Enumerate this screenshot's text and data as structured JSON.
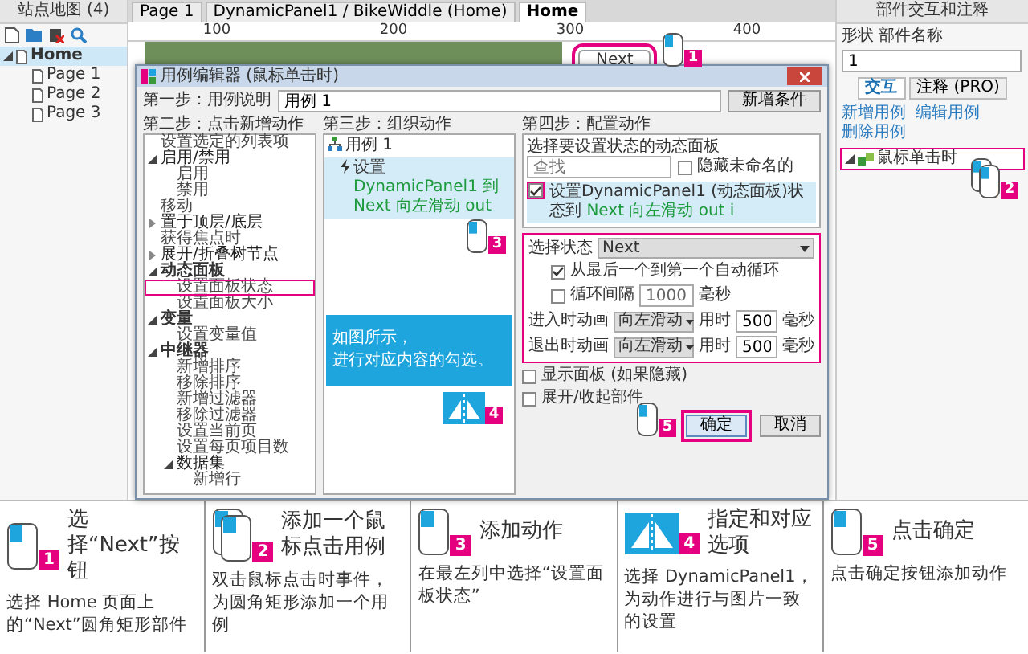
{
  "sitemap": {
    "title": "站点地图 (4)",
    "pages": [
      {
        "label": "Home",
        "selected": true,
        "expanded": true,
        "children": [
          {
            "label": "Page 1",
            "selected": false
          },
          {
            "label": "Page 2",
            "selected": false
          },
          {
            "label": "Page 3",
            "selected": false
          }
        ]
      }
    ]
  },
  "tabs": [
    {
      "label": "Page 1",
      "selected": false
    },
    {
      "label": "DynamicPanel1 / BikeWiddle (Home)",
      "selected": false
    },
    {
      "label": "Home",
      "selected": true
    }
  ],
  "ruler": [
    "100",
    "200",
    "300",
    "400"
  ],
  "canvas": {
    "widget_label": "Next"
  },
  "inspector": {
    "title": "部件交互和注释",
    "name_label": "形状 部件名称",
    "name_value": "1",
    "tabs": [
      {
        "label": "交互",
        "selected": true
      },
      {
        "label": "注释 (PRO)",
        "selected": false
      }
    ],
    "links": [
      "新增用例",
      "编辑用例",
      "删除用例"
    ],
    "events": [
      {
        "label": "鼠标单击时",
        "expanded": true
      }
    ]
  },
  "dialog": {
    "title": "用例编辑器 (鼠标单击时)",
    "step1_label": "第一步：用例说明",
    "case_name": "用例 1",
    "add_condition": "新增条件",
    "step2_label": "第二步：点击新增动作",
    "actions": [
      {
        "label": "设置选定的列表项",
        "kind": "action",
        "selected": false
      },
      {
        "label": "启用/禁用",
        "kind": "group",
        "expanded": true,
        "selected": false,
        "children": [
          {
            "label": "启用",
            "kind": "action",
            "selected": false
          },
          {
            "label": "禁用",
            "kind": "action",
            "selected": false
          }
        ]
      },
      {
        "label": "移动",
        "kind": "action",
        "selected": false
      },
      {
        "label": "置于顶层/底层",
        "kind": "group",
        "expanded": false,
        "selected": false
      },
      {
        "label": "获得焦点时",
        "kind": "action",
        "selected": false
      },
      {
        "label": "展开/折叠树节点",
        "kind": "group",
        "expanded": false,
        "selected": false
      },
      {
        "label": "动态面板",
        "kind": "category",
        "expanded": true,
        "selected": false,
        "children": [
          {
            "label": "设置面板状态",
            "kind": "action",
            "selected": true
          },
          {
            "label": "设置面板大小",
            "kind": "action",
            "selected": false
          }
        ]
      },
      {
        "label": "变量",
        "kind": "category",
        "expanded": true,
        "selected": false,
        "children": [
          {
            "label": "设置变量值",
            "kind": "action",
            "selected": false
          }
        ]
      },
      {
        "label": "中继器",
        "kind": "category",
        "expanded": true,
        "selected": false,
        "children": [
          {
            "label": "新增排序",
            "kind": "action",
            "selected": false
          },
          {
            "label": "移除排序",
            "kind": "action",
            "selected": false
          },
          {
            "label": "新增过滤器",
            "kind": "action",
            "selected": false
          },
          {
            "label": "移除过滤器",
            "kind": "action",
            "selected": false
          },
          {
            "label": "设置当前页",
            "kind": "action",
            "selected": false
          },
          {
            "label": "设置每页项目数",
            "kind": "action",
            "selected": false
          },
          {
            "label": "数据集",
            "kind": "group",
            "expanded": true,
            "selected": false,
            "children": [
              {
                "label": "新增行",
                "kind": "action",
                "selected": false
              }
            ]
          }
        ]
      }
    ],
    "step3_label": "第三步：组织动作",
    "case_item": "用例 1",
    "case_action": {
      "verb": "设置",
      "detail": "DynamicPanel1 到 Next 向左滑动 out",
      "selected": true
    },
    "step4_label": "第四步：配置动作",
    "panel_select_label": "选择要设置状态的动态面板",
    "search_placeholder": "查找",
    "hide_unnamed": {
      "label": "隐藏未命名的",
      "checked": false
    },
    "panel_item": {
      "text": "设置DynamicPanel1 (动态面板)状态到",
      "detail": "Next 向左滑动 out i",
      "checked": true
    },
    "state_label": "选择状态",
    "state_value": "Next",
    "wrap": {
      "label": "从最后一个到第一个自动循环",
      "checked": true
    },
    "loop": {
      "label": "循环间隔",
      "value": "1000",
      "unit": "毫秒",
      "checked": false
    },
    "animations": [
      {
        "label": "进入时动画",
        "value": "向左滑动",
        "time_label": "用时",
        "time": "500",
        "unit": "毫秒"
      },
      {
        "label": "退出时动画",
        "value": "向左滑动",
        "time_label": "用时",
        "time": "500",
        "unit": "毫秒"
      }
    ],
    "options": [
      {
        "label": "显示面板 (如果隐藏)",
        "checked": false
      },
      {
        "label": "展开/收起部件",
        "checked": false
      }
    ],
    "ok": "确定",
    "cancel": "取消"
  },
  "callout": {
    "lines": [
      "如图所示，",
      "进行对应内容的勾选。"
    ]
  },
  "markers": [
    {
      "number": "1",
      "kind": "mouse"
    },
    {
      "number": "2",
      "kind": "double-mouse"
    },
    {
      "number": "3",
      "kind": "mouse"
    },
    {
      "number": "4",
      "kind": "panel"
    },
    {
      "number": "5",
      "kind": "mouse"
    }
  ],
  "steps": [
    {
      "number": "1",
      "kind": "mouse",
      "title": "选择“Next”按钮",
      "text": "选择 Home 页面上的“Next”圆角矩形部件"
    },
    {
      "number": "2",
      "kind": "double-mouse",
      "title": "添加一个鼠标点击用例",
      "text": "双击鼠标点击时事件，为圆角矩形添加一个用例"
    },
    {
      "number": "3",
      "kind": "mouse",
      "title": "添加动作",
      "text": "在最左列中选择“设置面板状态”"
    },
    {
      "number": "4",
      "kind": "panel",
      "title": "指定和对应选项",
      "text": "选择 DynamicPanel1，为动作进行与图片一致的设置"
    },
    {
      "number": "5",
      "kind": "mouse",
      "title": "点击确定",
      "text": "点击确定按钮添加动作"
    }
  ]
}
